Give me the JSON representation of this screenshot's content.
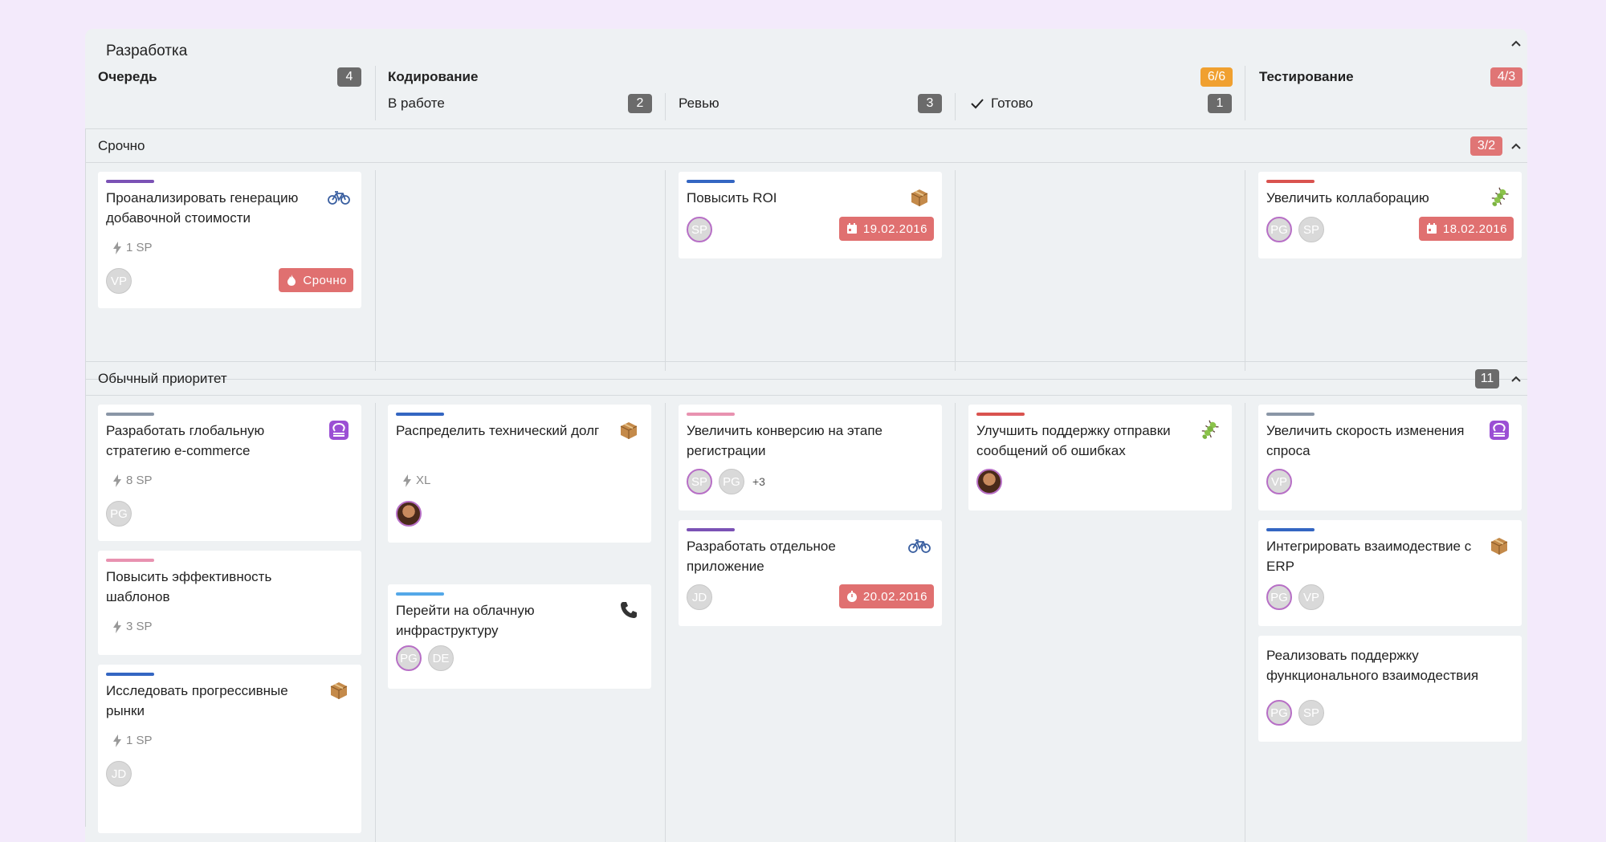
{
  "board": {
    "title": "Разработка"
  },
  "columns": {
    "queue": {
      "label": "Очередь",
      "count": "4"
    },
    "coding": {
      "label": "Кодирование",
      "count": "6/6"
    },
    "in_progress": {
      "label": "В работе",
      "count": "2"
    },
    "review": {
      "label": "Ревью",
      "count": "3"
    },
    "done": {
      "label": "Готово",
      "count": "1"
    },
    "testing": {
      "label": "Тестирование",
      "count": "4/3"
    }
  },
  "lanes": {
    "urgent": {
      "label": "Срочно",
      "count": "3/2"
    },
    "normal": {
      "label": "Обычный приоритет",
      "count": "11"
    }
  },
  "colors": {
    "purple": "#7b52b5",
    "blue": "#3466c2",
    "red": "#d9534f",
    "pink": "#e892b0",
    "gray": "#8a96a6",
    "lightblue": "#54a8e8",
    "badge_red": "#e07070",
    "badge_orange": "#f0a030"
  },
  "cards": {
    "u1": {
      "title": "Проанализировать генерацию добавочной стоимости",
      "icon": "bicycle-icon",
      "sp": "1 SP",
      "avatars": [
        "VP"
      ],
      "badge": "Срочно"
    },
    "u2": {
      "title": "Повысить ROI",
      "icon": "package-icon",
      "avatars": [
        "SP"
      ],
      "date": "19.02.2016"
    },
    "u3": {
      "title": "Увеличить коллаборацию",
      "icon": "bug-icon",
      "avatars": [
        "PG",
        "SP"
      ],
      "date": "18.02.2016"
    },
    "n1": {
      "title": "Разработать глобальную стратегию e-commerce",
      "icon": "libra-icon",
      "sp": "8 SP",
      "avatars": [
        "PG"
      ]
    },
    "n2": {
      "title": "Повысить эффективность шаблонов",
      "sp": "3 SP"
    },
    "n3": {
      "title": "Исследовать прогрессивные рынки",
      "icon": "package-icon",
      "sp": "1 SP",
      "avatars": [
        "JD"
      ]
    },
    "n4": {
      "title": "Распределить технический долг",
      "icon": "package-icon",
      "sp": "XL"
    },
    "n5": {
      "title": "Перейти на облачную инфраструктуру",
      "icon": "phone-icon",
      "avatars": [
        "PG",
        "DE"
      ]
    },
    "n6": {
      "title": "Увеличить конверсию на этапе регистрации",
      "avatars": [
        "SP",
        "PG"
      ],
      "more": "+3"
    },
    "n7": {
      "title": "Разработать отдельное приложение",
      "icon": "bicycle-icon",
      "avatars": [
        "JD"
      ],
      "date": "20.02.2016"
    },
    "n8": {
      "title": "Улучшить поддержку отправки сообщений об ошибках",
      "icon": "bug-icon"
    },
    "n9": {
      "title": "Увеличить скорость изменения спроса",
      "icon": "libra-icon",
      "avatars": [
        "VP"
      ]
    },
    "n10": {
      "title": "Интегрировать взаимодествие с ERP",
      "icon": "package-icon",
      "avatars": [
        "PG",
        "VP"
      ]
    },
    "n11": {
      "title": "Реализовать поддержку функционального взаимодествия",
      "avatars": [
        "PG",
        "SP"
      ]
    }
  }
}
